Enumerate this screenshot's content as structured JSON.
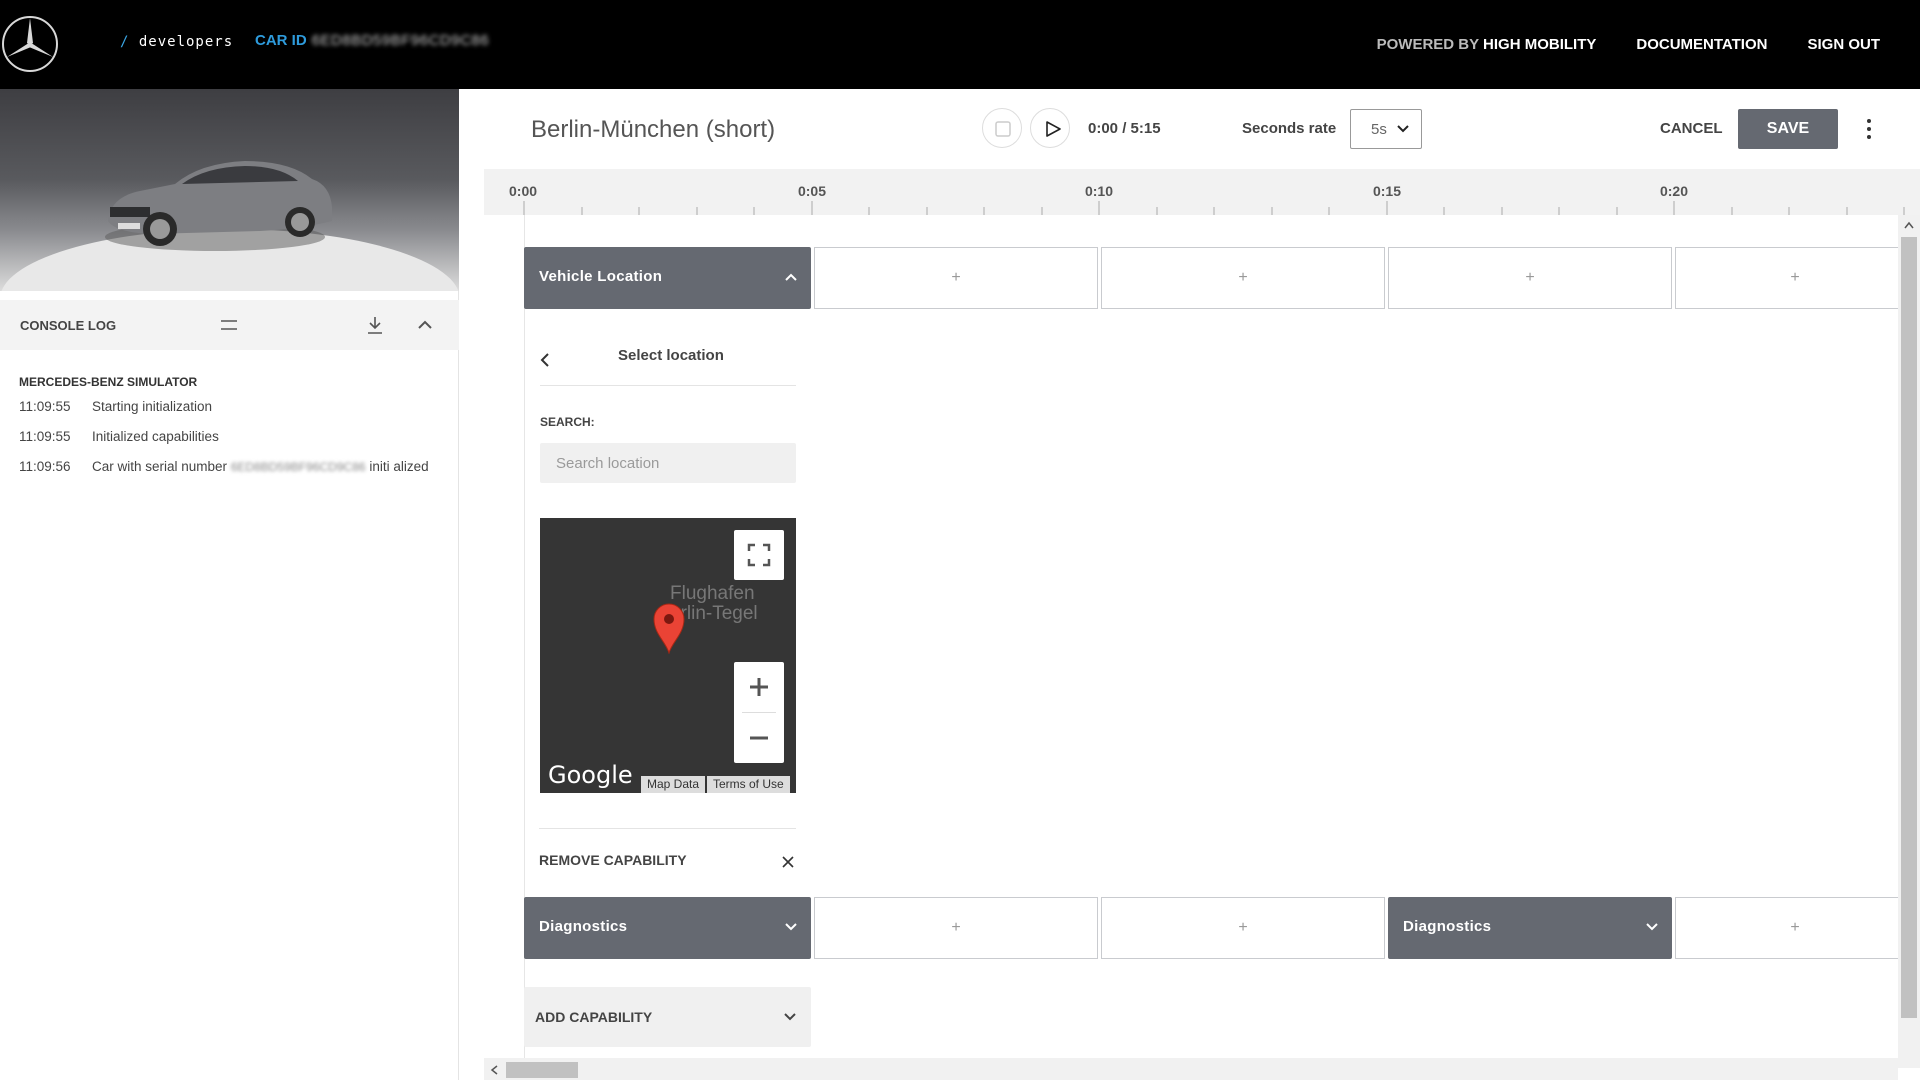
{
  "header": {
    "brand_suffix": "developers",
    "car_id_label": "CAR ID",
    "car_id_value": "6ED8BD59BF96CD9C86",
    "powered_by": "POWERED BY",
    "powered_brand": "HIGH MOBILITY",
    "nav": [
      "DOCUMENTATION",
      "SIGN OUT"
    ]
  },
  "console": {
    "title": "CONSOLE LOG",
    "section_title": "MERCEDES-BENZ SIMULATOR",
    "entries": [
      {
        "time": "11:09:55",
        "message": "Starting initialization"
      },
      {
        "time": "11:09:55",
        "message": "Initialized capabilities"
      },
      {
        "time": "11:09:56",
        "message_prefix": "Car with serial number",
        "serial": "6ED8BD59BF96CD9C86",
        "message_suffix": "initi alized"
      }
    ]
  },
  "toolbar": {
    "trip_title": "Berlin-München (short)",
    "time_display": "0:00 / 5:15",
    "seconds_rate_label": "Seconds rate",
    "seconds_rate_value": "5s",
    "cancel_label": "CANCEL",
    "save_label": "SAVE"
  },
  "ruler": {
    "ticks": [
      "0:00",
      "0:05",
      "0:10",
      "0:15",
      "0:20"
    ]
  },
  "timeline": {
    "slot_symbol": "+",
    "rows": [
      {
        "label": "Vehicle Location",
        "expanded": true
      },
      {
        "label": "Diagnostics",
        "expanded": false,
        "second_label": "Diagnostics"
      }
    ],
    "location_panel": {
      "title": "Select location",
      "search_label": "SEARCH:",
      "search_placeholder": "Search location",
      "map_label_line1": "Flughafen",
      "map_label_line2": "erlin-Tegel",
      "map_logo": "Google",
      "map_data": "Map Data",
      "terms": "Terms of Use",
      "remove_label": "REMOVE CAPABILITY"
    },
    "add_capability_label": "ADD CAPABILITY"
  },
  "colors": {
    "topbar": "#000000",
    "accent_blue": "#2e9bdc",
    "capability_bar": "#656971",
    "pin_red": "#ea4335"
  }
}
